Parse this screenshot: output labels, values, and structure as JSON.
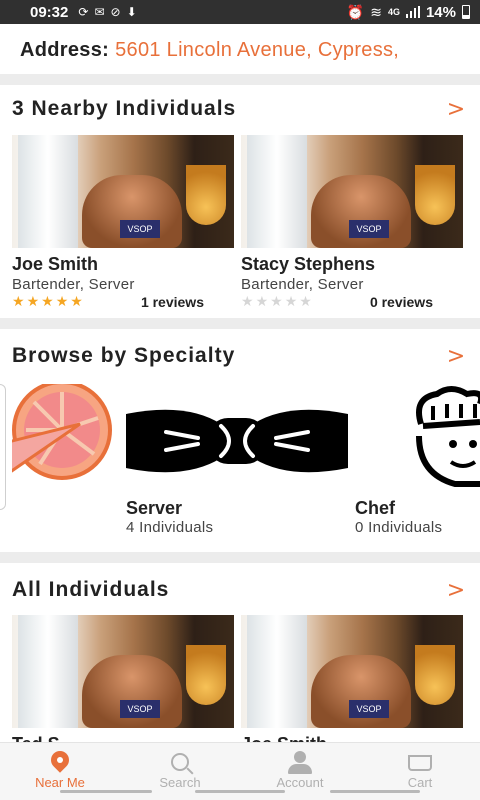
{
  "status_bar": {
    "time": "09:32",
    "battery": "14%",
    "network": "4G"
  },
  "address": {
    "label": "Address:",
    "value": "5601 Lincoln Avenue, Cypress,"
  },
  "nearby": {
    "title": "3 Nearby Individuals",
    "people": [
      {
        "name": "Joe Smith",
        "role": "Bartender, Server",
        "rating": 5,
        "reviews": "1 reviews"
      },
      {
        "name": "Stacy Stephens",
        "role": "Bartender, Server",
        "rating": 0,
        "reviews": "0 reviews"
      }
    ]
  },
  "specialty": {
    "title": "Browse by Specialty",
    "items": [
      {
        "name": "Server",
        "count": "4 Individuals",
        "icon": "bow-tie-icon"
      },
      {
        "name": "Chef",
        "count": "0 Individuals",
        "icon": "chef-hat-icon"
      }
    ],
    "partial_icon": "grapefruit-icon"
  },
  "all": {
    "title": "All Individuals",
    "people": [
      {
        "name": "Ted S",
        "role": ""
      },
      {
        "name": "Joe Smith",
        "role": ""
      }
    ]
  },
  "bottom_nav": {
    "items": [
      {
        "label": "Near Me",
        "icon": "location-pin-icon",
        "active": true
      },
      {
        "label": "Search",
        "icon": "search-icon",
        "active": false
      },
      {
        "label": "Account",
        "icon": "account-icon",
        "active": false
      },
      {
        "label": "Cart",
        "icon": "cart-icon",
        "active": false
      }
    ]
  },
  "colors": {
    "accent": "#e8703a",
    "star": "#f5a623",
    "divider": "#ececec"
  }
}
